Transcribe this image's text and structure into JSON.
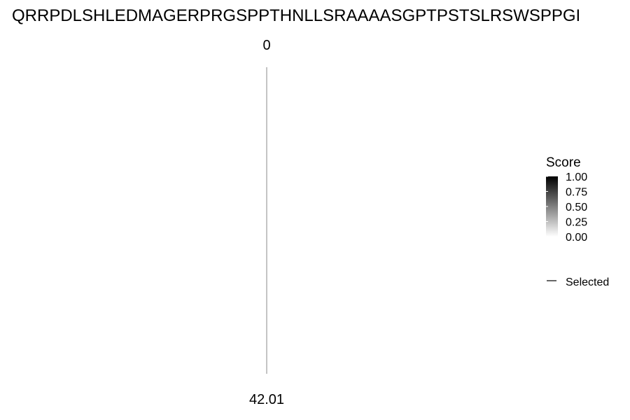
{
  "chart_data": {
    "type": "line",
    "title": "QRRPDLSHLEDMAGERPRGSPPTHNLLSRAAAASGPTPSTSLRSWSPPGI",
    "top_label": "0",
    "bottom_label": "42.01",
    "series": [
      {
        "name": "Selected",
        "x": [
          0,
          0
        ],
        "y": [
          0,
          42.01
        ],
        "color": "#888888"
      }
    ],
    "legend": {
      "placement": "right",
      "score_title": "Score",
      "score_ticks": [
        "1.00",
        "0.75",
        "0.50",
        "0.25",
        "0.00"
      ],
      "score_range": [
        0,
        1
      ],
      "score_colors": [
        "#ffffff",
        "#000000"
      ],
      "line_label": "Selected"
    }
  }
}
